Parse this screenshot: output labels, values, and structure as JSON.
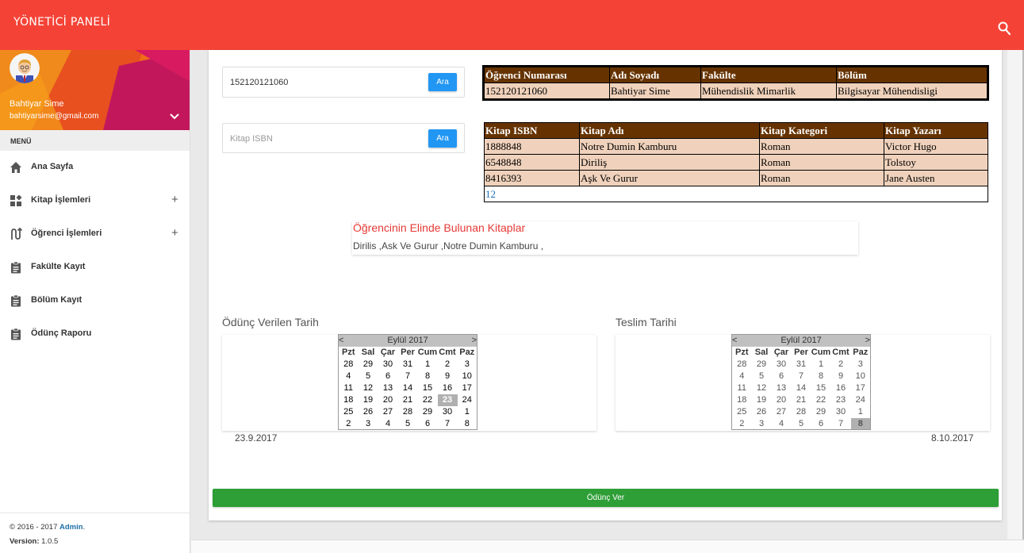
{
  "navbar": {
    "brand": "YÖNETİCİ PANELİ"
  },
  "user": {
    "name": "Bahtiyar Sime",
    "email": "bahtiyarsime@gmail.com"
  },
  "menu": {
    "header": "MENÜ",
    "items": [
      {
        "label": "Ana Sayfa",
        "icon": "home-icon",
        "expandable": false
      },
      {
        "label": "Kitap İşlemleri",
        "icon": "widgets-icon",
        "expandable": true
      },
      {
        "label": "Öğrenci İşlemleri",
        "icon": "route-icon",
        "expandable": true
      },
      {
        "label": "Fakülte Kayıt",
        "icon": "clipboard-icon",
        "expandable": false
      },
      {
        "label": "Bölüm Kayıt",
        "icon": "clipboard-icon",
        "expandable": false
      },
      {
        "label": "Ödünç Raporu",
        "icon": "clipboard-icon",
        "expandable": false
      }
    ],
    "plus_symbol": "+"
  },
  "legal": {
    "copyright_prefix": "© 2016 - 2017 ",
    "admin": "Admin",
    "copyright_suffix": ".",
    "version_label": "Version:",
    "version_value": " 1.0.5"
  },
  "student_search": {
    "value": "152120121060",
    "button": "Ara"
  },
  "book_search": {
    "placeholder": "Kitap ISBN",
    "button": "Ara"
  },
  "student_table": {
    "headers": [
      "Öğrenci Numarası",
      "Adı Soyadı",
      "Fakülte",
      "Bölüm"
    ],
    "rows": [
      [
        "152120121060",
        "Bahtiyar Sime",
        "Mühendislik Mimarlik",
        "Bilgisayar Mühendisligi"
      ]
    ]
  },
  "book_table": {
    "headers": [
      "Kitap ISBN",
      "Kitap Adı",
      "Kitap Kategori",
      "Kitap Yazarı"
    ],
    "rows": [
      [
        "1888848",
        "Notre Dumin Kamburu",
        "Roman",
        "Victor Hugo"
      ],
      [
        "6548848",
        "Diriliş",
        "Roman",
        "Tolstoy"
      ],
      [
        "8416393",
        "Aşk Ve Gurur",
        "Roman",
        "Jane Austen"
      ]
    ],
    "pager": "12"
  },
  "books_held": {
    "title": "Öğrencinin Elinde Bulunan Kitaplar",
    "list": "Dirilis ,Ask Ve Gurur ,Notre Dumin Kamburu ,"
  },
  "loan_date": {
    "label": "Ödünç Verilen Tarih",
    "value": "23.9.2017",
    "calendar": {
      "prev": "<",
      "next": ">",
      "month": "Eylül 2017",
      "days_of_week": [
        "Pzt",
        "Sal",
        "Çar",
        "Per",
        "Cum",
        "Cmt",
        "Paz"
      ],
      "weeks": [
        [
          "28",
          "29",
          "30",
          "31",
          "1",
          "2",
          "3"
        ],
        [
          "4",
          "5",
          "6",
          "7",
          "8",
          "9",
          "10"
        ],
        [
          "11",
          "12",
          "13",
          "14",
          "15",
          "16",
          "17"
        ],
        [
          "18",
          "19",
          "20",
          "21",
          "22",
          "23",
          "24"
        ],
        [
          "25",
          "26",
          "27",
          "28",
          "29",
          "30",
          "1"
        ],
        [
          "2",
          "3",
          "4",
          "5",
          "6",
          "7",
          "8"
        ]
      ],
      "selected": "23"
    }
  },
  "return_date": {
    "label": "Teslim Tarihi",
    "value": "8.10.2017",
    "calendar": {
      "prev": "<",
      "next": ">",
      "month": "Eylül 2017",
      "days_of_week": [
        "Pzt",
        "Sal",
        "Çar",
        "Per",
        "Cum",
        "Cmt",
        "Paz"
      ],
      "weeks": [
        [
          "28",
          "29",
          "30",
          "31",
          "1",
          "2",
          "3"
        ],
        [
          "4",
          "5",
          "6",
          "7",
          "8",
          "9",
          "10"
        ],
        [
          "11",
          "12",
          "13",
          "14",
          "15",
          "16",
          "17"
        ],
        [
          "18",
          "19",
          "20",
          "21",
          "22",
          "23",
          "24"
        ],
        [
          "25",
          "26",
          "27",
          "28",
          "29",
          "30",
          "1"
        ],
        [
          "2",
          "3",
          "4",
          "5",
          "6",
          "7",
          "8"
        ]
      ],
      "selected": "8"
    }
  },
  "submit": {
    "label": "Ödünç Ver"
  },
  "colors": {
    "navbar": "#f44336",
    "table_header": "#663300",
    "table_row": "#f0d2bc",
    "button_blue": "#2196f3",
    "button_green": "#2e9e36",
    "accent_red": "#e53935"
  }
}
